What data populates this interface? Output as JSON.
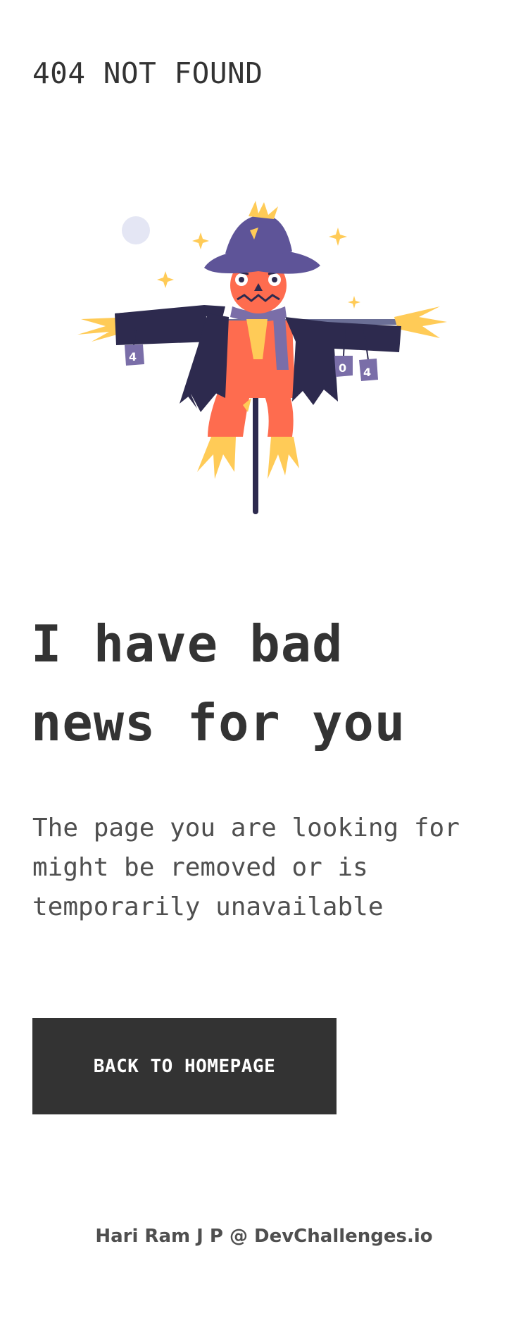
{
  "header": {
    "brand": "404 NOT FOUND"
  },
  "illustration": {
    "name": "scarecrow-illustration",
    "left_can_label": "4",
    "right_can_labels": [
      "0",
      "4"
    ],
    "colors": {
      "coat": "#2d2a4e",
      "hat": "#5e5498",
      "head": "#fe6c4f",
      "straw": "#ffcb57",
      "scarf": "#7a6ea8",
      "moon": "#e4e6f4"
    }
  },
  "main": {
    "headline_line1": "I have bad",
    "headline_line2": "news for you",
    "message": "The page you are looking for might be removed or is temporarily unavailable",
    "button_label": "BACK TO HOMEPAGE"
  },
  "footer": {
    "credit": "Hari Ram J P @ DevChallenges.io"
  },
  "colors": {
    "text": "#333333",
    "muted": "#4f4f4f",
    "button_bg": "#333333",
    "button_text": "#ffffff",
    "background": "#ffffff"
  }
}
